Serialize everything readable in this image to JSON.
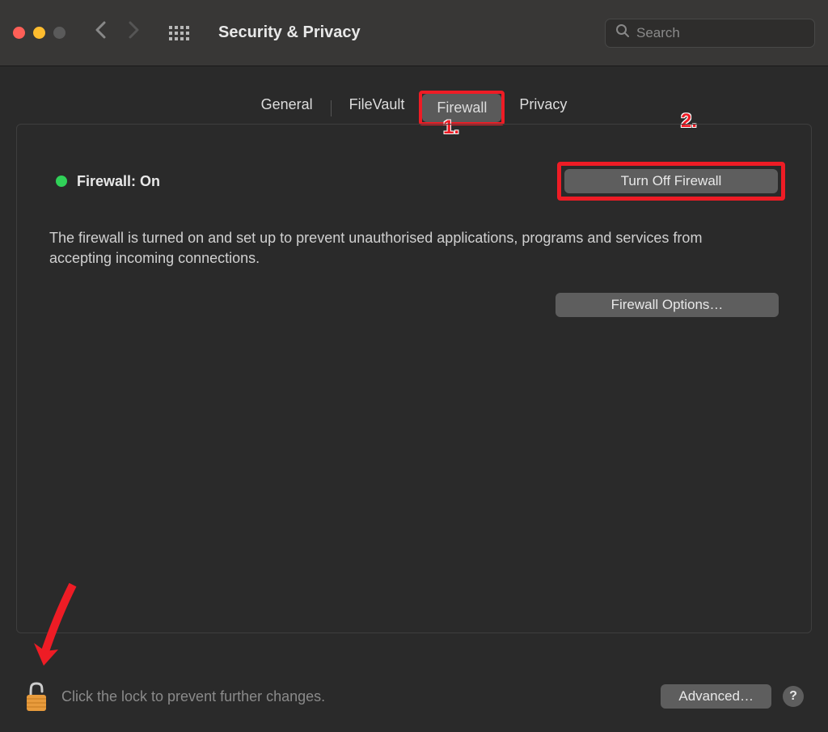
{
  "window": {
    "title": "Security & Privacy",
    "search_placeholder": "Search"
  },
  "tabs": {
    "general": "General",
    "filevault": "FileVault",
    "firewall": "Firewall",
    "privacy": "Privacy"
  },
  "main": {
    "status_label": "Firewall: On",
    "turn_off_label": "Turn Off Firewall",
    "description": "The firewall is turned on and set up to prevent unauthorised applications, programs and services from accepting incoming connections.",
    "options_label": "Firewall Options…"
  },
  "footer": {
    "lock_text": "Click the lock to prevent further changes.",
    "advanced_label": "Advanced…",
    "help_label": "?"
  },
  "annotations": {
    "label1": "1.",
    "label2": "2."
  }
}
